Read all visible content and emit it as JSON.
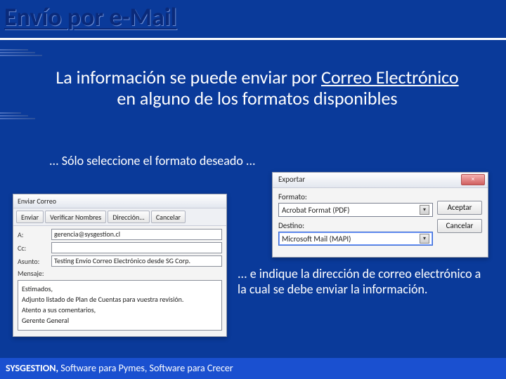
{
  "title": "Envío por e-Mail",
  "intro_prefix": "La información se puede enviar por ",
  "intro_link": "Correo Electrónico",
  "intro_suffix": " en alguno de los formatos disponibles",
  "step1": "... Sólo seleccione el formato deseado ...",
  "export": {
    "title": "Exportar",
    "close": "×",
    "format_label": "Formato:",
    "format_value": "Acrobat Format (PDF)",
    "dest_label": "Destino:",
    "dest_value": "Microsoft Mail (MAPI)",
    "accept": "Aceptar",
    "cancel": "Cancelar"
  },
  "mail": {
    "title": "Enviar Correo",
    "toolbar": {
      "send": "Enviar",
      "verify": "Verificar Nombres",
      "address": "Dirección...",
      "cancel": "Cancelar"
    },
    "to_label": "A:",
    "to_value": "gerencia@sysgestion.cl",
    "cc_label": "Cc:",
    "cc_value": "",
    "subject_label": "Asunto:",
    "subject_value": "Testing Envío Correo Electrónico desde SG Corp.",
    "msg_label": "Mensaje:",
    "msg_line1": "Estimados,",
    "msg_line2": "Adjunto listado de Plan de Cuentas para vuestra revisión.",
    "msg_line3": "Atento a sus comentarios,",
    "msg_line4": "Gerente General"
  },
  "step2": "... e indique la dirección de correo electrónico a la cual se debe enviar la información.",
  "footer_bold": "SYSGESTION,",
  "footer_rest": " Software para Pymes, Software para Crecer"
}
